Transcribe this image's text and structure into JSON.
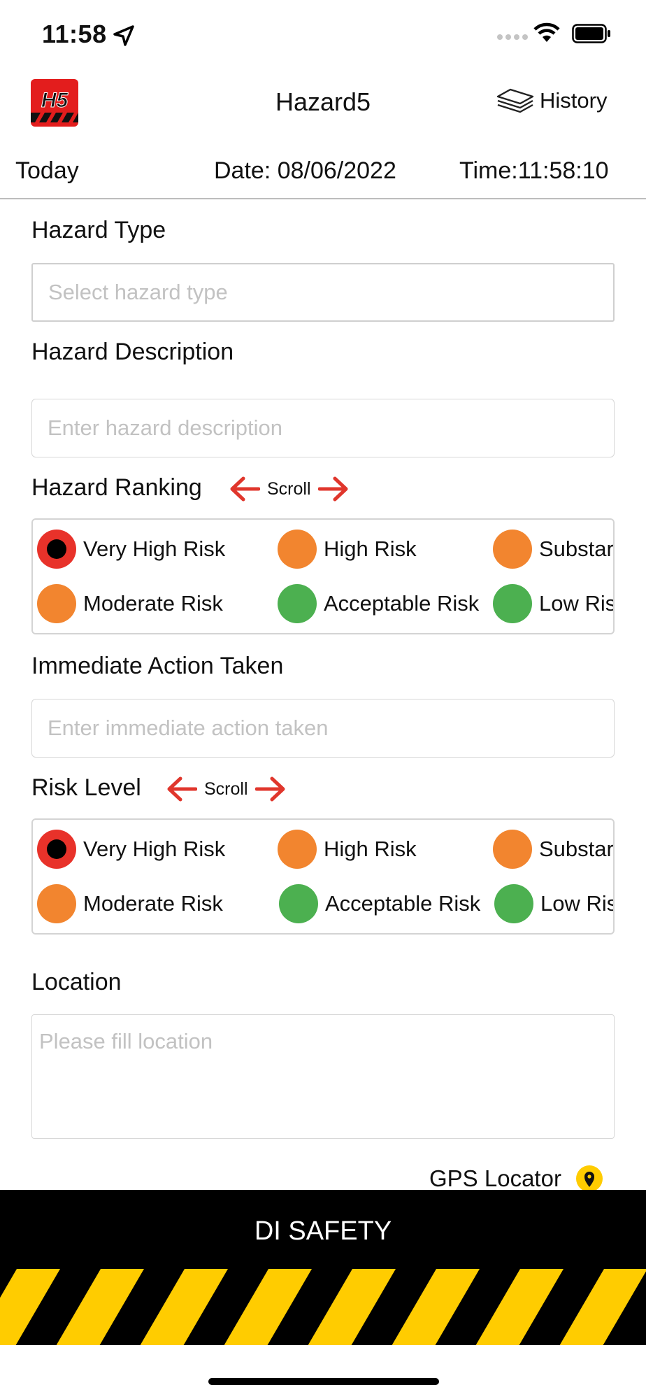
{
  "status_bar": {
    "time": "11:58",
    "icons": [
      "location-arrow-icon",
      "signal-dots-icon",
      "wifi-icon",
      "battery-icon"
    ]
  },
  "header": {
    "logo_text": "H5",
    "title": "Hazard5",
    "history_label": "History"
  },
  "date_row": {
    "today": "Today",
    "date": "Date: 08/06/2022",
    "time": "Time:11:58:10"
  },
  "form": {
    "hazard_type": {
      "label": "Hazard Type",
      "placeholder": "Select hazard type",
      "value": ""
    },
    "hazard_description": {
      "label": "Hazard Description",
      "placeholder": "Enter hazard description",
      "value": ""
    },
    "hazard_ranking": {
      "label": "Hazard Ranking",
      "scroll_hint": "Scroll",
      "options": [
        {
          "label": "Very High Risk",
          "color": "#e8322a",
          "selected": true
        },
        {
          "label": "High Risk",
          "color": "#f2852f",
          "selected": false
        },
        {
          "label": "Substar",
          "color": "#f2852f",
          "selected": false
        },
        {
          "label": "Moderate Risk",
          "color": "#f2852f",
          "selected": false
        },
        {
          "label": "Acceptable Risk",
          "color": "#4cb050",
          "selected": false
        },
        {
          "label": "Low Ris",
          "color": "#4cb050",
          "selected": false
        }
      ]
    },
    "immediate_action": {
      "label": "Immediate Action Taken",
      "placeholder": "Enter immediate action taken",
      "value": ""
    },
    "risk_level": {
      "label": "Risk Level",
      "scroll_hint": "Scroll",
      "options": [
        {
          "label": "Very High Risk",
          "color": "#e8322a",
          "selected": true
        },
        {
          "label": "High Risk",
          "color": "#f2852f",
          "selected": false
        },
        {
          "label": "Substar",
          "color": "#f2852f",
          "selected": false
        },
        {
          "label": "Moderate Risk",
          "color": "#f2852f",
          "selected": false
        },
        {
          "label": "Acceptable Risk",
          "color": "#4cb050",
          "selected": false
        },
        {
          "label": "Low Ris",
          "color": "#4cb050",
          "selected": false
        }
      ]
    },
    "location": {
      "label": "Location",
      "placeholder": "Please fill location",
      "value": ""
    },
    "gps_locator_label": "GPS Locator"
  },
  "footer": {
    "title": "DI SAFETY"
  },
  "colors": {
    "scroll_arrow": "#e0362c",
    "stripe_yellow": "#ffcc00",
    "footer_bg": "#000000"
  }
}
